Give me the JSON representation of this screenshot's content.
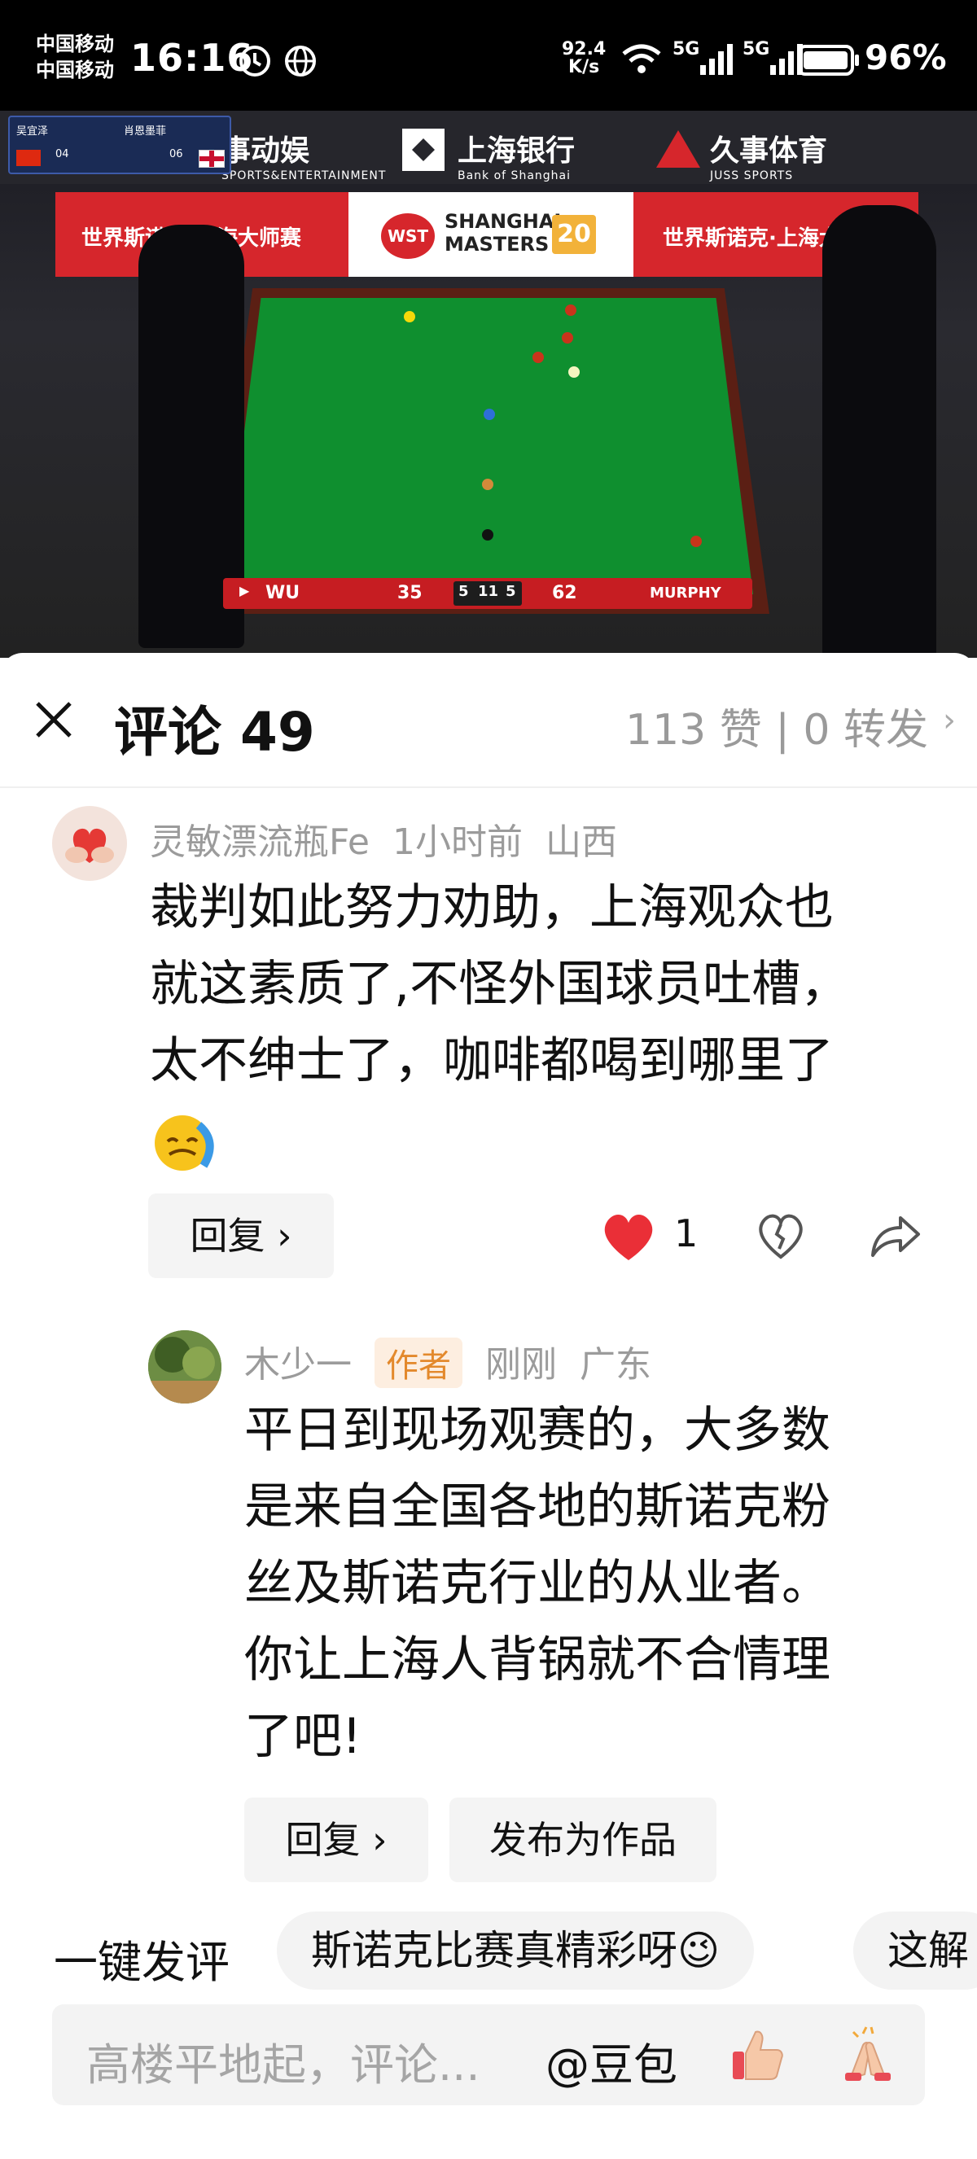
{
  "status_bar": {
    "carrier_1": "中国移动",
    "carrier_2": "中国移动",
    "time": "16:16",
    "net_speed_value": "92.4",
    "net_speed_unit": "K/s",
    "signal_1_label": "5G",
    "signal_2_label": "5G",
    "battery": "96%"
  },
  "video": {
    "sponsors": {
      "left": "事动娱",
      "left_sub": "SPORTS&ENTERTAINMENT",
      "center": "上海银行",
      "center_sub": "Bank of Shanghai",
      "right": "久事体育",
      "right_sub": "JUSS SPORTS"
    },
    "banner": {
      "left_text": "世界斯诺克·上海大师赛",
      "wst": "WST",
      "title_line1": "SHANGHAI",
      "title_line2": "MASTERS",
      "anniversary": "20",
      "right_text": "世界斯诺克·上海大师"
    },
    "score_chip": {
      "player1": "吴宜泽",
      "player1_frames": "04",
      "player2": "肖恩墨菲",
      "player2_frames": "06"
    },
    "scoreboard": {
      "player_left": "WU",
      "score_left": "35",
      "frames_left": "5",
      "best_of": "11",
      "frames_right": "5",
      "score_right": "62",
      "player_right": "MURPHY"
    }
  },
  "header": {
    "title": "评论 49",
    "stats": "113 赞 | 0 转发"
  },
  "comments": [
    {
      "username": "灵敏漂流瓶Fe",
      "time": "1小时前",
      "location": "山西",
      "text_lines": [
        "裁判如此努力劝助，上海观众也",
        "就这素质了,不怪外国球员吐槽，",
        "太不绅士了，咖啡都喝到哪里了"
      ],
      "reply_label": "回复 ›",
      "like_count": "1"
    }
  ],
  "reply": {
    "username": "木少一",
    "badge": "作者",
    "time": "刚刚",
    "location": "广东",
    "text_lines": [
      "平日到现场观赛的，大多数",
      "是来自全国各地的斯诺克粉",
      "丝及斯诺克行业的从业者。",
      "你让上海人背锅就不合情理",
      "了吧!"
    ],
    "reply_label": "回复 ›",
    "publish_label": "发布为作品"
  },
  "quick_comment": {
    "label": "一键发评",
    "chips": [
      "斯诺克比赛真精彩呀😉",
      "这解"
    ]
  },
  "input": {
    "placeholder": "高楼平地起，评论...",
    "mention": "@豆包"
  },
  "colors": {
    "like_red": "#ea2f37",
    "felt_green": "#0f8f2f",
    "banner_red": "#d6262c",
    "author_badge_bg": "#fdeee0",
    "author_badge_text": "#e3892c"
  }
}
